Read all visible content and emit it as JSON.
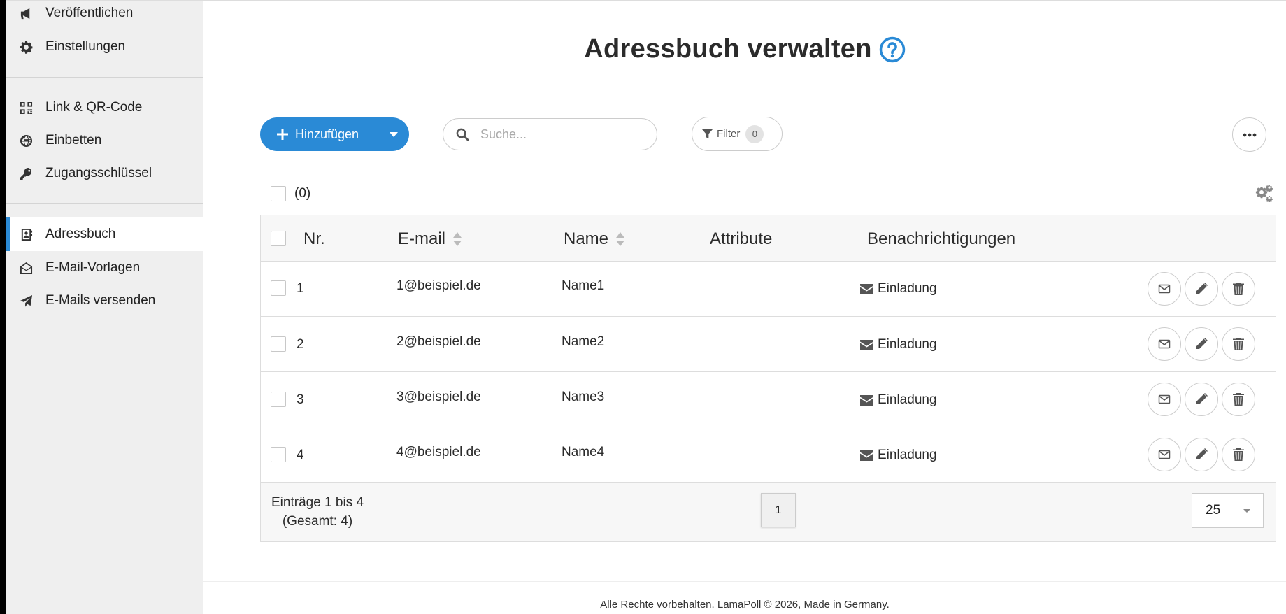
{
  "sidebar": {
    "items": [
      {
        "label": "Veröffentlichen",
        "icon": "megaphone-icon"
      },
      {
        "label": "Einstellungen",
        "icon": "gear-icon"
      },
      {
        "label": "Link & QR-Code",
        "icon": "qr-code-icon"
      },
      {
        "label": "Einbetten",
        "icon": "globe-icon"
      },
      {
        "label": "Zugangsschlüssel",
        "icon": "key-icon"
      },
      {
        "label": "Adressbuch",
        "icon": "address-book-icon",
        "active": true
      },
      {
        "label": "E-Mail-Vorlagen",
        "icon": "envelope-open-icon"
      },
      {
        "label": "E-Mails versenden",
        "icon": "paper-plane-icon"
      }
    ]
  },
  "header": {
    "title": "Adressbuch verwalten"
  },
  "toolbar": {
    "add_label": "Hinzufügen",
    "search_placeholder": "Suche...",
    "filter_label": "Filter",
    "filter_count": "0"
  },
  "selection": {
    "count_label": "(0)"
  },
  "table": {
    "columns": [
      "Nr.",
      "E-mail",
      "Name",
      "Attribute",
      "Benachrichtigungen"
    ],
    "rows": [
      {
        "nr": "1",
        "email": "1@beispiel.de",
        "name": "Name1",
        "notification": "Einladung"
      },
      {
        "nr": "2",
        "email": "2@beispiel.de",
        "name": "Name2",
        "notification": "Einladung"
      },
      {
        "nr": "3",
        "email": "3@beispiel.de",
        "name": "Name3",
        "notification": "Einladung"
      },
      {
        "nr": "4",
        "email": "4@beispiel.de",
        "name": "Name4",
        "notification": "Einladung"
      }
    ]
  },
  "pagination": {
    "entries_line1": "Einträge 1 bis 4",
    "entries_line2": "(Gesamt: 4)",
    "current_page": "1",
    "per_page": "25"
  },
  "footer": {
    "text": "Alle Rechte vorbehalten. LamaPoll © 2026, Made in Germany."
  },
  "colors": {
    "accent": "#2a8ad6",
    "sidebar_bg": "#efefef"
  }
}
